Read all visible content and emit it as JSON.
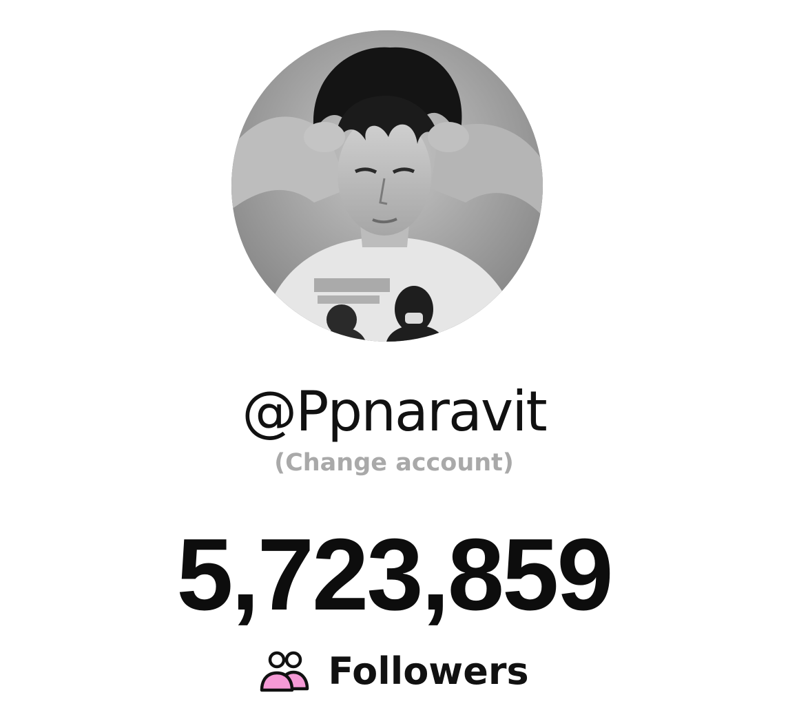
{
  "profile": {
    "avatar": "profile-photo",
    "username": "@Ppnaravit",
    "change_account_label": "(Change account)"
  },
  "stats": {
    "count": "5,723,859",
    "label": "Followers",
    "icon": "followers-icon"
  },
  "colors": {
    "background": "#ffffff",
    "text": "#111111",
    "muted": "#a9a9a9",
    "icon_accent": "#f59ad6"
  }
}
